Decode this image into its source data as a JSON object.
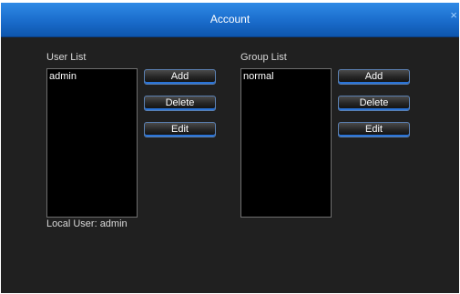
{
  "window": {
    "title": "Account",
    "close_glyph": "×"
  },
  "user_list": {
    "label": "User List",
    "items": [
      "admin"
    ],
    "buttons": {
      "add": "Add",
      "delete": "Delete",
      "edit": "Edit"
    },
    "status": "Local User:  admin"
  },
  "group_list": {
    "label": "Group List",
    "items": [
      "normal"
    ],
    "buttons": {
      "add": "Add",
      "delete": "Delete",
      "edit": "Edit"
    }
  },
  "colors": {
    "title_bar": "#1a6ccb",
    "panel_background": "#202020",
    "button_accent": "#2a73d6"
  }
}
